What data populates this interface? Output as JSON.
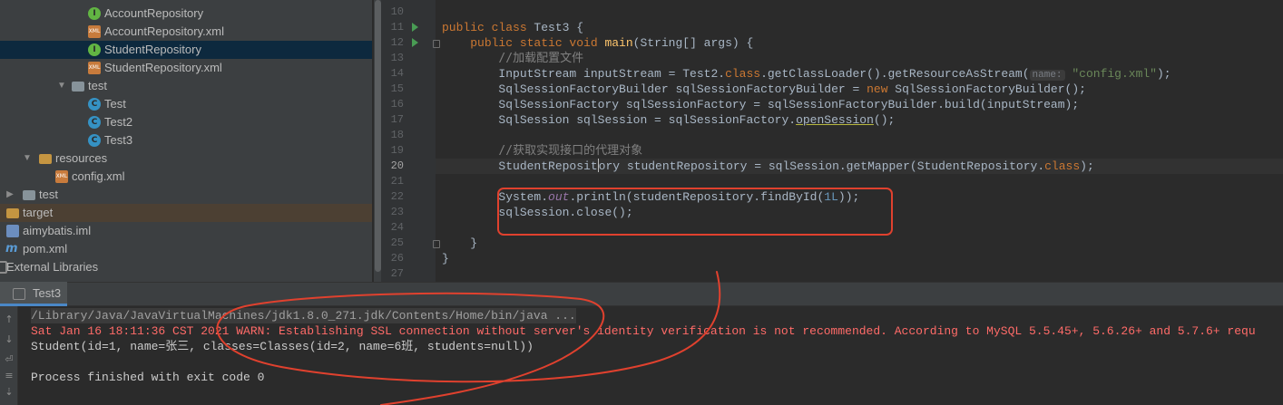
{
  "project_tree": {
    "items": [
      {
        "label": "AccountRepository",
        "icon": "interface-icon"
      },
      {
        "label": "AccountRepository.xml",
        "icon": "xml-file-icon"
      },
      {
        "label": "StudentRepository",
        "icon": "interface-icon"
      },
      {
        "label": "StudentRepository.xml",
        "icon": "xml-file-icon"
      },
      {
        "label": "test",
        "icon": "folder-icon"
      },
      {
        "label": "Test",
        "icon": "class-icon"
      },
      {
        "label": "Test2",
        "icon": "class-icon"
      },
      {
        "label": "Test3",
        "icon": "class-icon"
      },
      {
        "label": "resources",
        "icon": "resources-folder-icon"
      },
      {
        "label": "config.xml",
        "icon": "xml-file-icon"
      },
      {
        "label": "test",
        "icon": "folder-icon"
      },
      {
        "label": "target",
        "icon": "folder-icon"
      },
      {
        "label": "aimybatis.iml",
        "icon": "iml-file-icon"
      },
      {
        "label": "pom.xml",
        "icon": "maven-icon"
      },
      {
        "label": "External Libraries",
        "icon": "library-icon"
      }
    ]
  },
  "editor": {
    "line_numbers": [
      "10",
      "11",
      "12",
      "13",
      "14",
      "15",
      "16",
      "17",
      "18",
      "19",
      "20",
      "21",
      "22",
      "23",
      "24",
      "25",
      "26",
      "27"
    ],
    "current_line": "20",
    "code": {
      "l11_kw": "public class ",
      "l11_name": "Test3 {",
      "l12_kw": "public static void ",
      "l12_fn": "main",
      "l12_rest": "(String[] args) {",
      "l13_comment": "//加载配置文件",
      "l14_a": "InputStream inputStream = Test2.",
      "l14_kw": "class",
      "l14_b": ".getClassLoader().getResourceAsStream(",
      "l14_hint": "name:",
      "l14_str": "\"config.xml\"",
      "l14_end": ");",
      "l15_a": "SqlSessionFactoryBuilder sqlSessionFactoryBuilder = ",
      "l15_kw": "new",
      "l15_b": " SqlSessionFactoryBuilder();",
      "l16": "SqlSessionFactory sqlSessionFactory = sqlSessionFactoryBuilder.build(inputStream);",
      "l17_a": "SqlSession sqlSession = sqlSessionFactory.",
      "l17_u": "openSession",
      "l17_b": "();",
      "l19_comment": "//获取实现接口的代理对象",
      "l20_a": "StudentReposit",
      "l20_b": "ory studentRepository = sqlSession.getMapper(StudentRepository.",
      "l20_kw": "class",
      "l20_end": ");",
      "l22_a": "System.",
      "l22_fld": "out",
      "l22_b": ".println(studentRepository.findById(",
      "l22_num": "1L",
      "l22_end": "));",
      "l23": "sqlSession.close();",
      "l25": "}",
      "l26": "}"
    }
  },
  "run_panel": {
    "tab_label": "Test3",
    "lines": {
      "path": "/Library/Java/JavaVirtualMachines/jdk1.8.0_271.jdk/Contents/Home/bin/java ...",
      "warn": "Sat Jan 16 18:11:36 CST 2021 WARN: Establishing SSL connection without server's identity verification is not recommended. According to MySQL 5.5.45+, 5.6.26+ and 5.7.6+ requ",
      "output": "Student(id=1, name=张三, classes=Classes(id=2, name=6班, students=null))",
      "exit": "Process finished with exit code 0"
    },
    "side_icons": [
      "up-arrow-icon",
      "down-arrow-icon",
      "wrap-icon",
      "print-icon",
      "scroll-to-end-icon"
    ]
  },
  "colors": {
    "annotation": "#e0412e",
    "selection": "#0d293e",
    "error_text": "#ff6b68"
  }
}
